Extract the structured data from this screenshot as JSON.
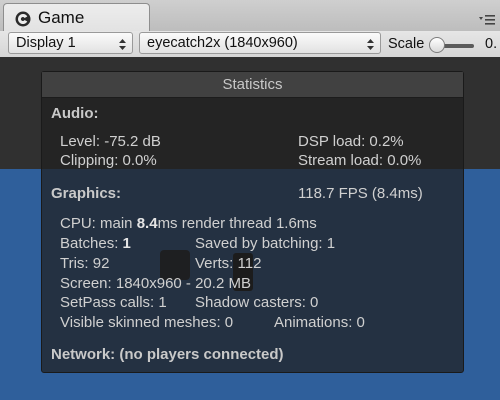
{
  "tab": {
    "title": "Game",
    "icon": "unity-game-icon"
  },
  "toolbar": {
    "display": "Display 1",
    "resolution": "eyecatch2x (1840x960)",
    "scale_label": "Scale",
    "scale_value": "0."
  },
  "stats": {
    "title": "Statistics",
    "audio": {
      "heading": "Audio:",
      "level": "Level: -75.2 dB",
      "dsp": "DSP load: 0.2%",
      "clipping": "Clipping: 0.0%",
      "stream": "Stream load: 0.0%"
    },
    "graphics": {
      "heading": "Graphics:",
      "fps": "118.7 FPS (8.4ms)",
      "cpu_prefix": "CPU: main",
      "cpu_main": "8.4",
      "cpu_suffix": "ms  render thread 1.6ms",
      "batches_label": "Batches:",
      "batches_value": "1",
      "saved": "Saved by batching: 1",
      "tris": "Tris: 92",
      "verts": "Verts: 112",
      "screen": "Screen: 1840x960 - 20.2 MB",
      "setpass": "SetPass calls: 1",
      "shadow": "Shadow casters: 0",
      "skinned": "Visible skinned meshes: 0",
      "animations": "Animations: 0"
    },
    "network": "Network: (no players connected)"
  },
  "colors": {
    "game_background": "#303030",
    "game_blue": "#2f5f9b",
    "overlay": "#202020"
  }
}
